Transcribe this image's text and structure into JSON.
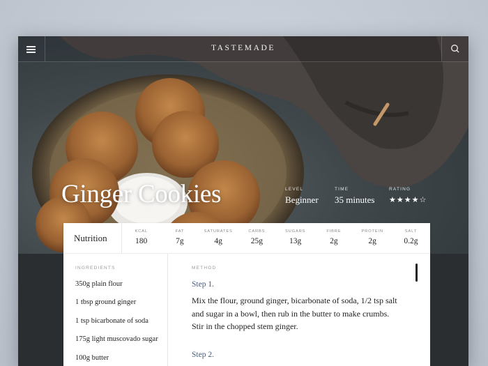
{
  "header": {
    "brand": "TASTEMADE"
  },
  "icons": {
    "menu": "hamburger-icon",
    "search": "search-icon"
  },
  "recipe": {
    "title": "Ginger Cookies",
    "level_label": "LEVEL",
    "level": "Beginner",
    "time_label": "TIME",
    "time": "35 minutes",
    "rating_label": "RATING",
    "rating_stars": "★★★★☆",
    "rating_value": 4,
    "rating_max": 5
  },
  "nutrition": {
    "title": "Nutrition",
    "items": [
      {
        "label": "KCAL",
        "value": "180"
      },
      {
        "label": "FAT",
        "value": "7g"
      },
      {
        "label": "SATURATES",
        "value": "4g"
      },
      {
        "label": "CARBS",
        "value": "25g"
      },
      {
        "label": "SUGARS",
        "value": "13g"
      },
      {
        "label": "FIBRE",
        "value": "2g"
      },
      {
        "label": "PROTEIN",
        "value": "2g"
      },
      {
        "label": "SALT",
        "value": "0.2g"
      }
    ]
  },
  "ingredients": {
    "label": "INGREDIENTS",
    "items": [
      "350g plain flour",
      "1 tbsp ground ginger",
      "1 tsp bicarbonate of soda",
      "175g light muscovado sugar",
      "100g butter"
    ]
  },
  "method": {
    "label": "METHOD",
    "steps": [
      {
        "title": "Step 1.",
        "text": "Mix the flour, ground ginger, bicarbonate of soda, 1/2 tsp salt and sugar in a bowl, then rub in the butter to make crumbs. Stir in the chopped stem ginger."
      },
      {
        "title": "Step 2.",
        "text": ""
      }
    ]
  },
  "colors": {
    "step_accent": "#4a5a78",
    "dark_bg": "#2b2e31"
  }
}
